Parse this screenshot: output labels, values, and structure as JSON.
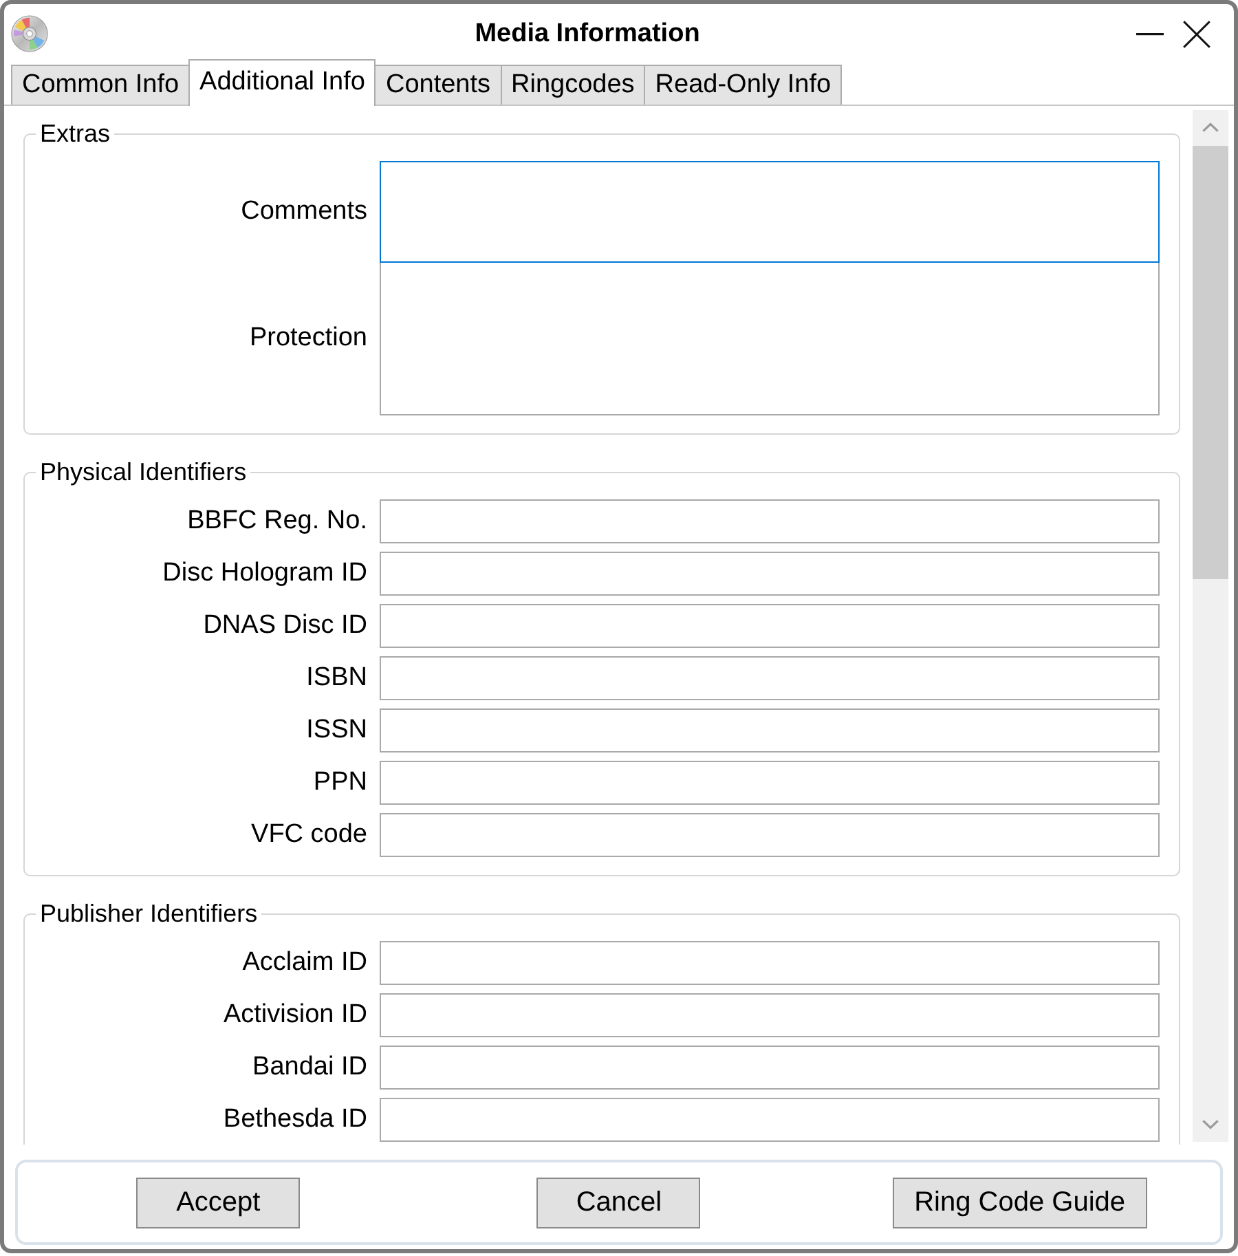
{
  "window": {
    "title": "Media Information"
  },
  "tabs": [
    {
      "label": "Common Info",
      "selected": false
    },
    {
      "label": "Additional Info",
      "selected": true
    },
    {
      "label": "Contents",
      "selected": false
    },
    {
      "label": "Ringcodes",
      "selected": false
    },
    {
      "label": "Read-Only Info",
      "selected": false
    }
  ],
  "groups": [
    {
      "title": "Extras",
      "fields": [
        {
          "label": "Comments",
          "kind": "multiline",
          "focused": true
        },
        {
          "label": "Protection",
          "kind": "multiline",
          "focused": false
        }
      ]
    },
    {
      "title": "Physical Identifiers",
      "fields": [
        {
          "label": "BBFC Reg. No.",
          "kind": "line",
          "focused": false
        },
        {
          "label": "Disc Hologram ID",
          "kind": "line",
          "focused": false
        },
        {
          "label": "DNAS Disc ID",
          "kind": "line",
          "focused": false
        },
        {
          "label": "ISBN",
          "kind": "line",
          "focused": false
        },
        {
          "label": "ISSN",
          "kind": "line",
          "focused": false
        },
        {
          "label": "PPN",
          "kind": "line",
          "focused": false
        },
        {
          "label": "VFC code",
          "kind": "line",
          "focused": false
        }
      ]
    },
    {
      "title": "Publisher Identifiers",
      "fields": [
        {
          "label": "Acclaim ID",
          "kind": "line",
          "focused": false
        },
        {
          "label": "Activision ID",
          "kind": "line",
          "focused": false
        },
        {
          "label": "Bandai ID",
          "kind": "line",
          "focused": false
        },
        {
          "label": "Bethesda ID",
          "kind": "line",
          "focused": false
        }
      ]
    }
  ],
  "buttons": [
    "Accept",
    "Cancel",
    "Ring Code Guide"
  ]
}
